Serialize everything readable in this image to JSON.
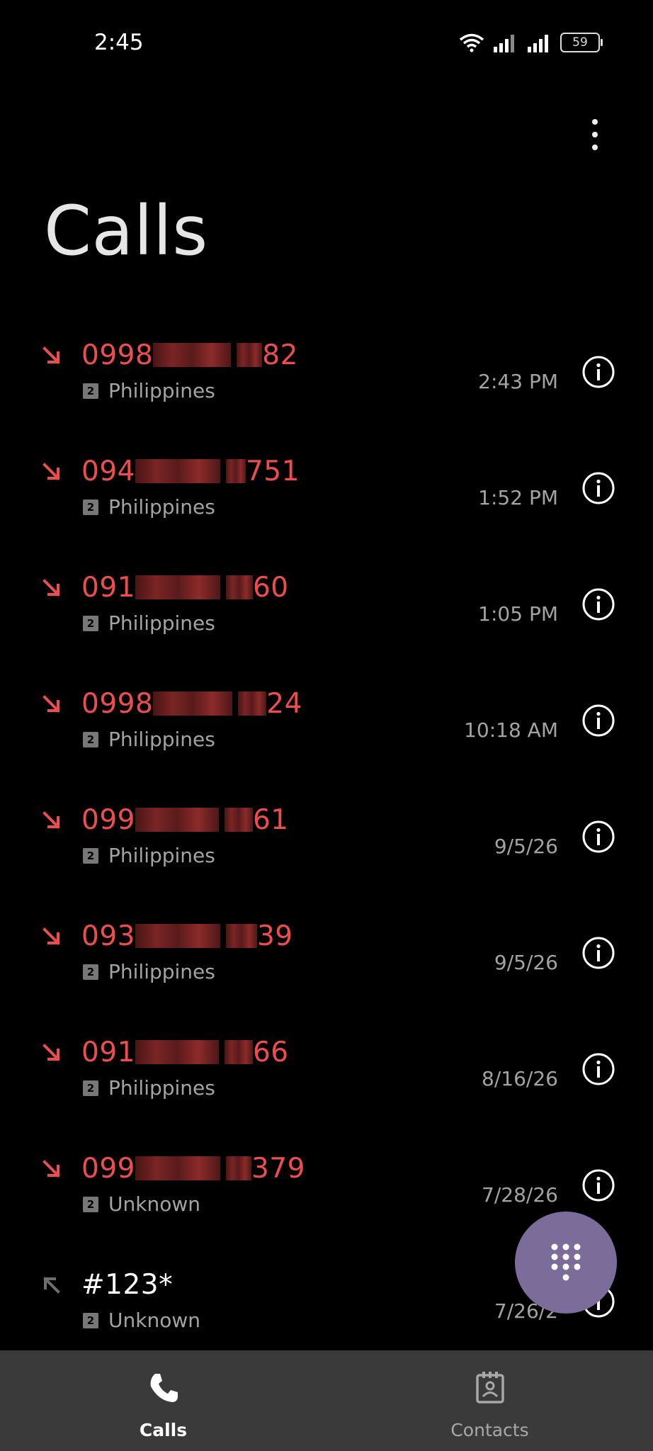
{
  "status_bar": {
    "time": "2:45",
    "battery_level": "59"
  },
  "header": {
    "title": "Calls"
  },
  "calls": [
    {
      "prefix": "0998",
      "suffix": "82",
      "type": "missed",
      "sim": "2",
      "location": "Philippines",
      "time": "2:43 PM"
    },
    {
      "prefix": "094",
      "suffix": "751",
      "type": "missed",
      "sim": "2",
      "location": "Philippines",
      "time": "1:52 PM"
    },
    {
      "prefix": "091",
      "suffix": "60",
      "type": "missed",
      "sim": "2",
      "location": "Philippines",
      "time": "1:05 PM"
    },
    {
      "prefix": "0998",
      "suffix": "24",
      "type": "missed",
      "sim": "2",
      "location": "Philippines",
      "time": "10:18 AM"
    },
    {
      "prefix": "099",
      "suffix": "61",
      "type": "missed",
      "sim": "2",
      "location": "Philippines",
      "time": "9/5/26"
    },
    {
      "prefix": "093",
      "suffix": "39",
      "type": "missed",
      "sim": "2",
      "location": "Philippines",
      "time": "9/5/26"
    },
    {
      "prefix": "091",
      "suffix": "66",
      "type": "missed",
      "sim": "2",
      "location": "Philippines",
      "time": "8/16/26"
    },
    {
      "prefix": "099",
      "suffix": "379",
      "type": "missed",
      "sim": "2",
      "location": "Unknown",
      "time": "7/28/26"
    },
    {
      "prefix": "#123*",
      "suffix": "",
      "type": "outgoing",
      "sim": "2",
      "location": "Unknown",
      "time": "7/26/2"
    }
  ],
  "bottom_nav": {
    "calls_label": "Calls",
    "contacts_label": "Contacts"
  },
  "colors": {
    "missed": "#ef4d4d",
    "fab": "#7b6c99",
    "nav_bg": "#3a3a3a"
  },
  "icons": {
    "missed": "missed-call-arrow-icon",
    "outgoing": "outgoing-call-arrow-icon",
    "info": "info-icon",
    "dialpad": "dialpad-icon",
    "phone": "phone-icon",
    "contacts": "contacts-book-icon",
    "more": "more-vertical-icon"
  }
}
